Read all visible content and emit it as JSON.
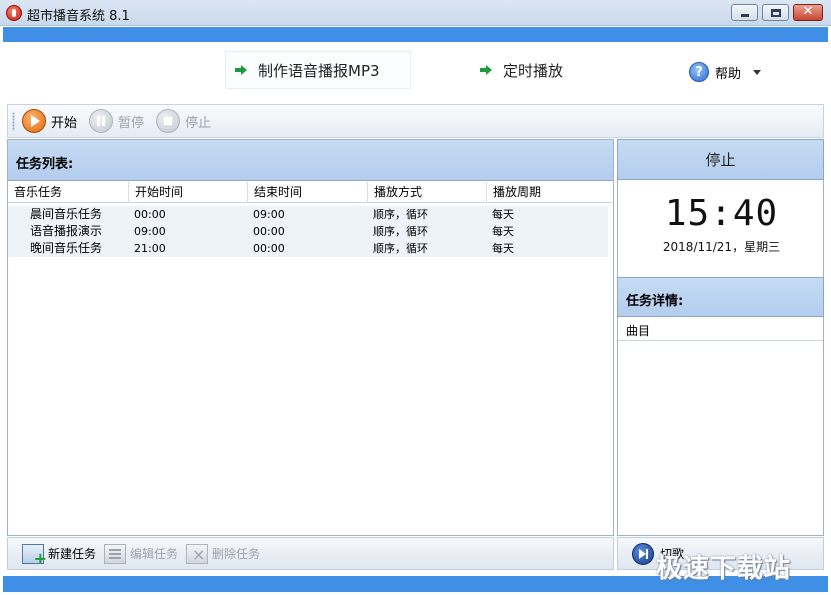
{
  "window": {
    "title": "超市播音系统 8.1"
  },
  "header": {
    "make_mp3_label": "制作语音播报MP3",
    "timer_label": "定时播放",
    "help_label": "帮助"
  },
  "toolbar": {
    "start_label": "开始",
    "pause_label": "暂停",
    "stop_label": "停止"
  },
  "task_list": {
    "title": "任务列表:",
    "columns": [
      "音乐任务",
      "开始时间",
      "结束时间",
      "播放方式",
      "播放周期"
    ],
    "rows": [
      [
        "晨间音乐任务",
        "00:00",
        "09:00",
        "顺序，循环",
        "每天"
      ],
      [
        "语音播报演示",
        "09:00",
        "00:00",
        "顺序，循环",
        "每天"
      ],
      [
        "晚间音乐任务",
        "21:00",
        "00:00",
        "顺序，循环",
        "每天"
      ]
    ],
    "footer": {
      "new_label": "新建任务",
      "edit_label": "编辑任务",
      "delete_label": "删除任务"
    }
  },
  "status_panel": {
    "status": "停止",
    "time": "15:40",
    "date": "2018/11/21，星期三"
  },
  "detail_panel": {
    "title": "任务详情:",
    "column": "曲目",
    "skip_label": "切歌"
  },
  "watermark": "极速下载站",
  "colors": {
    "accent_blue": "#3f8fe6",
    "panel_header": "#c5dbf3",
    "start_orange": "#e0670d"
  }
}
